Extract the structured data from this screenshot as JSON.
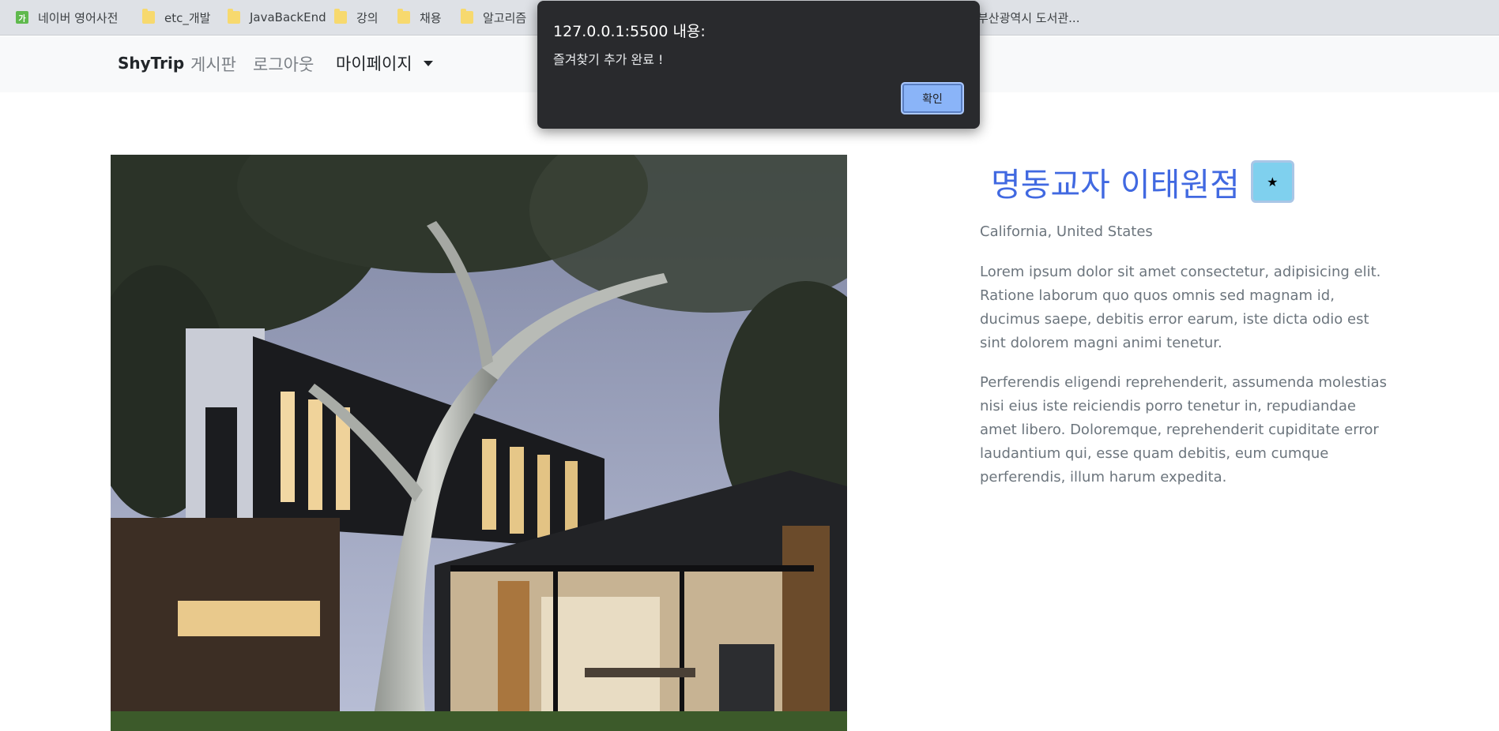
{
  "bookmarks": [
    {
      "label": "네이버 영어사전",
      "icon": "naver-dictionary-icon"
    },
    {
      "label": "etc_개발",
      "icon": "folder-icon"
    },
    {
      "label": "JavaBackEnd",
      "icon": "folder-icon"
    },
    {
      "label": "강의",
      "icon": "folder-icon"
    },
    {
      "label": "채용",
      "icon": "folder-icon"
    },
    {
      "label": "알고리즘",
      "icon": "folder-icon"
    },
    {
      "label": "부산광역시 도서관...",
      "icon": "bookmark-icon"
    }
  ],
  "bookmark_fav_glyph": "가",
  "navbar": {
    "brand": "ShyTrip",
    "links": [
      "게시판",
      "로그아웃"
    ],
    "dropdown": "마이페이지"
  },
  "detail": {
    "title": "명동교자 이태원점",
    "star": "★",
    "location": "California, United States",
    "paragraph1": "Lorem ipsum dolor sit amet consectetur, adipisicing elit. Ratione laborum quo quos omnis sed magnam id, ducimus saepe, debitis error earum, iste dicta odio est sint dolorem magni animi tenetur.",
    "paragraph2": "Perferendis eligendi reprehenderit, assumenda molestias nisi eius iste reiciendis porro tenetur in, repudiandae amet libero. Doloremque, reprehenderit cupiditate error laudantium qui, esse quam debitis, eum cumque perferendis, illum harum expedita."
  },
  "dialog": {
    "title": "127.0.0.1:5500 내용:",
    "message": "즐겨찾기 추가 완료 !",
    "ok": "확인"
  },
  "colors": {
    "title": "#4169e1",
    "star_button": "#7fd0ee",
    "dialog_bg": "#292a2d",
    "dialog_button": "#8ab4f8"
  }
}
